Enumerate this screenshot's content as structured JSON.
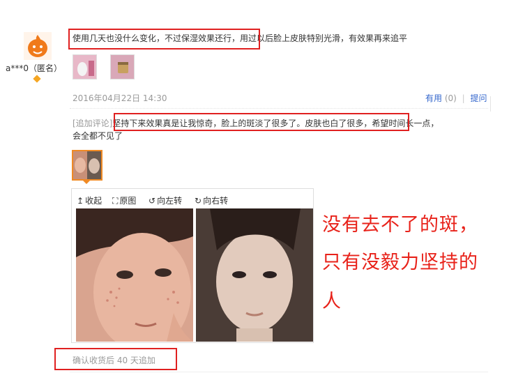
{
  "reviewer": {
    "name": "a***0（匿名）"
  },
  "review": {
    "text": "使用几天也没什么变化，不过保湿效果还行，用过以后脸上皮肤特别光滑，有效果再来追平",
    "date": "2016年04月22日 14:30",
    "useful_label": "有用",
    "useful_count": "(0)",
    "ask_label": "提问"
  },
  "followup": {
    "label": "[追加评论]",
    "text_line1": "坚持下来效果真是让我惊奇，脸上的斑淡了很多了。皮肤也白了很多，希望时间长一点，",
    "text_line2": "会全都不见了"
  },
  "viewer_toolbar": {
    "collapse": "收起",
    "original": "原图",
    "rotate_left": "向左转",
    "rotate_right": "向右转"
  },
  "overlay": {
    "line1": "没有去不了的斑，",
    "line2": "只有没毅力坚持的",
    "line3": "人"
  },
  "footer": {
    "text": "确认收货后 40 天追加"
  },
  "colors": {
    "highlight": "#e02020",
    "link": "#3366cc",
    "overlay_text": "#e8221a",
    "selected_thumb": "#f08a24"
  }
}
